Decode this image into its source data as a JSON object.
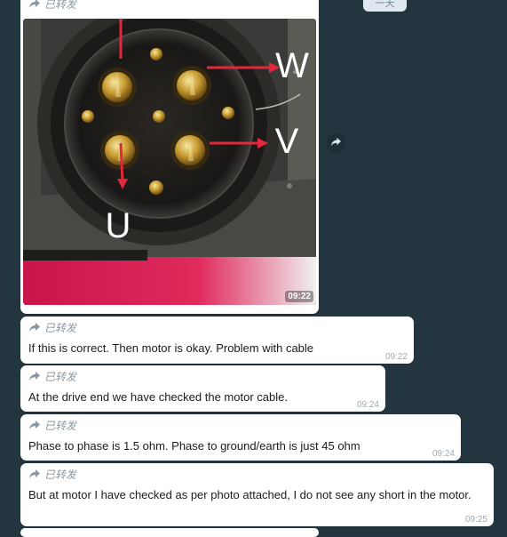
{
  "top_chip": {
    "text": "一天"
  },
  "image_message": {
    "forwarded_label": "已转发",
    "time": "09:22",
    "photo_labels": {
      "w": "W",
      "v": "V",
      "u": "U"
    }
  },
  "messages": [
    {
      "forwarded_label": "已转发",
      "text": "If this is correct. Then motor is okay. Problem with cable",
      "time": "09:22"
    },
    {
      "forwarded_label": "已转发",
      "text": "At the drive end we have checked the motor cable.",
      "time": "09:24"
    },
    {
      "forwarded_label": "已转发",
      "text": "Phase to phase is 1.5 ohm. Phase to ground/earth is just 45 ohm",
      "time": "09:24"
    },
    {
      "forwarded_label": "已转发",
      "text": "But at motor I have checked as per photo attached, I do not see any short in the motor.",
      "time": "09:25"
    }
  ],
  "icons": {
    "forward": "forward-arrow-icon",
    "share": "share-icon"
  },
  "colors": {
    "background": "#233640",
    "bubble": "#ffffff",
    "arrow": "#e1283c",
    "time": "#a1abb2"
  }
}
